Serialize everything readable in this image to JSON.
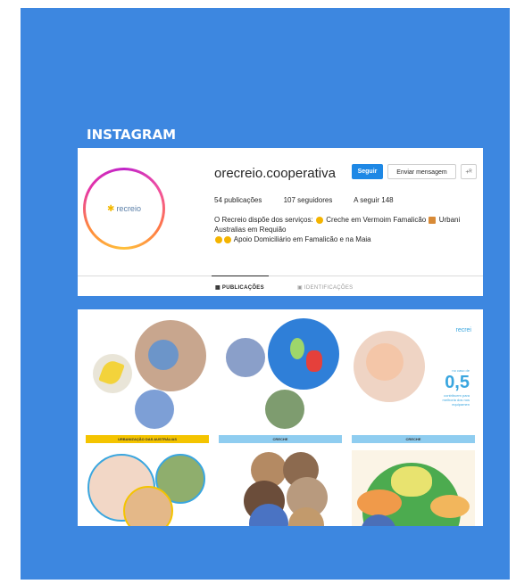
{
  "section": {
    "label": "INSTAGRAM"
  },
  "profile": {
    "username": "orecreio.cooperativa",
    "logo_text": "recreio",
    "follow_label": "Seguir",
    "message_label": "Enviar mensagem",
    "more_label": "+ᴿ",
    "stats": {
      "posts": "54 publicações",
      "followers": "107 seguidores",
      "following": "A seguir 148"
    },
    "bio": {
      "line1_prefix": "O Recreio dispõe dos serviços:",
      "line1_mid": "Creche em Vermoim Famalicão",
      "line1_suffix": "Urbani",
      "line2": "Australias em Requião",
      "line3": "Apoio Domiciliário em Famalicão e na Maia"
    },
    "tabs": {
      "posts": "▦ PUBLICAÇÕES",
      "tagged": "▣ IDENTIFICAÇÕES"
    }
  },
  "posts": [
    {
      "caption": "URBANIZAÇÃO DAS AUSTRÁLIAS",
      "bar_color": "#f4c400"
    },
    {
      "caption": "CRECHE",
      "bar_color": "#8fcdf0"
    },
    {
      "caption": "CRECHE",
      "bar_color": "#8fcdf0",
      "ad_brand": "recrei",
      "ad_small_top": "no caso de",
      "ad_value": "0,5",
      "ad_small_1": "contribuem para",
      "ad_small_2": "melhoria dos nos",
      "ad_small_3": "equipamen"
    },
    {
      "caption": ""
    },
    {
      "caption": ""
    },
    {
      "caption": ""
    }
  ],
  "colors": {
    "slide_background": "#3d87e0",
    "follow_button": "#1e88e5",
    "accent_yellow": "#f4c400",
    "accent_blue": "#8fcdf0"
  }
}
